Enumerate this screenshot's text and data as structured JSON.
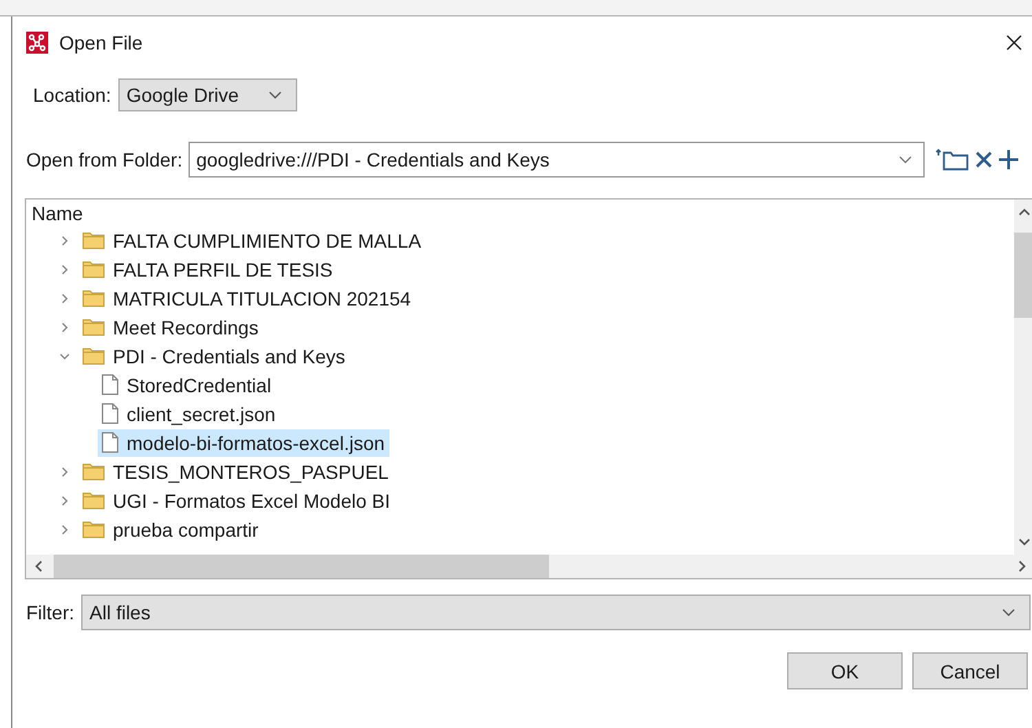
{
  "window": {
    "title": "Open File"
  },
  "location": {
    "label": "Location:",
    "value": "Google Drive"
  },
  "folder": {
    "label": "Open from Folder:",
    "value": "googledrive:///PDI - Credentials and Keys"
  },
  "tree": {
    "column": "Name",
    "items": [
      {
        "kind": "folder",
        "name": "FALTA CUMPLIMIENTO DE MALLA",
        "expanded": false,
        "selected": false
      },
      {
        "kind": "folder",
        "name": "FALTA PERFIL DE TESIS",
        "expanded": false,
        "selected": false
      },
      {
        "kind": "folder",
        "name": "MATRICULA TITULACION 202154",
        "expanded": false,
        "selected": false
      },
      {
        "kind": "folder",
        "name": "Meet Recordings",
        "expanded": false,
        "selected": false
      },
      {
        "kind": "folder",
        "name": "PDI - Credentials and Keys",
        "expanded": true,
        "selected": false,
        "children": [
          {
            "kind": "file",
            "name": "StoredCredential",
            "selected": false
          },
          {
            "kind": "file",
            "name": "client_secret.json",
            "selected": false
          },
          {
            "kind": "file",
            "name": "modelo-bi-formatos-excel.json",
            "selected": true
          }
        ]
      },
      {
        "kind": "folder",
        "name": "TESIS_MONTEROS_PASPUEL",
        "expanded": false,
        "selected": false
      },
      {
        "kind": "folder",
        "name": "UGI - Formatos Excel Modelo BI",
        "expanded": false,
        "selected": false
      },
      {
        "kind": "folder",
        "name": "prueba compartir",
        "expanded": false,
        "selected": false
      }
    ]
  },
  "filter": {
    "label": "Filter:",
    "value": "All files"
  },
  "buttons": [
    "OK",
    "Cancel"
  ]
}
